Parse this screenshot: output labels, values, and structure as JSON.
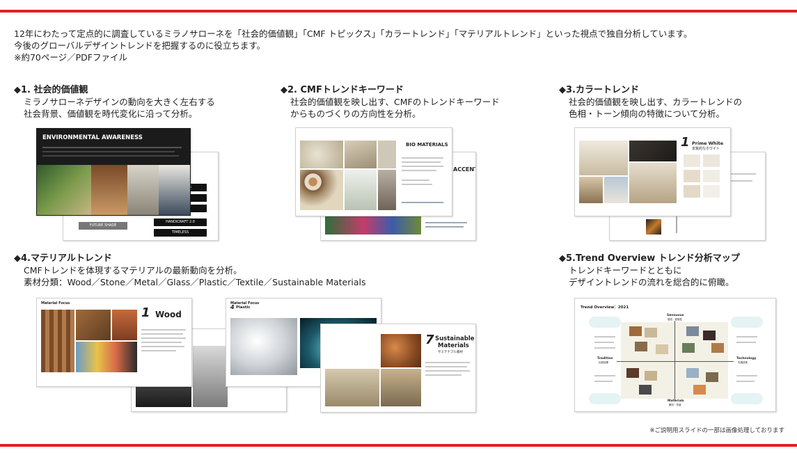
{
  "intro": {
    "line1": "12年にわたって定点的に調査しているミラノサローネを「社会的価値観」「CMF トピックス」「カラートレンド」「マテリアルトレンド」といった視点で独自分析しています。",
    "line2": "今後のグローバルデザイントレンドを把握するのに役立ちます。",
    "line3": "※約70ページ／PDFファイル"
  },
  "sections": [
    {
      "title": "◆1. 社会的価値観",
      "desc1": "ミラノサローネデザインの動向を大きく左右する",
      "desc2": "社会背景、価値観を時代変化に沿って分析。"
    },
    {
      "title": "◆2. CMFトレンドキーワード",
      "desc1": "社会的価値観を映し出す、CMFのトレンドキーワード",
      "desc2": "からものづくりの方向性を分析。"
    },
    {
      "title": "◆3.カラートレンド",
      "desc1": "社会的価値観を映し出す、カラートレンドの",
      "desc2": "色相・トーン傾向の特徴について分析。"
    },
    {
      "title": "◆4.マテリアルトレンド",
      "desc1": "CMFトレンドを体現するマテリアルの最新動向を分析。",
      "desc2": "素材分類：Wood／Stone／Metal／Glass／Plastic／Textile／Sustainable Materials"
    },
    {
      "title": "◆5.Trend Overview トレンド分析マップ",
      "desc1": "トレンドキーワードとともに",
      "desc2": "デザイントレンドの流れを総合的に俯瞰。"
    }
  ],
  "slides": {
    "env_title": "ENVIRONMENTAL AWARENESS",
    "env_btn1": "HARMONESS",
    "env_btn2": "HANDICRAFT 2.0",
    "env_btn3": "TIMELESS",
    "env_btn4": "FUTURE SHADE",
    "bio_title": "BIO MATERIALS",
    "accents": "ACCENTS",
    "color_no": "1",
    "color_title": "Prime White",
    "color_sub": "本質的なホワイト",
    "wood_no": "1",
    "wood_title": "Wood",
    "material_focus": "Material Focus",
    "plastic_no": "4",
    "plastic_title": "Plastic",
    "sust_no": "7",
    "sust_title1": "Sustainable",
    "sust_title2": "Materials",
    "sust_sub": "サステナブル素材",
    "overview_title": "Trend Overview：2021",
    "ov_top": "Sensuous",
    "ov_top_sub": "感覚・官能性",
    "ov_left": "Tradition",
    "ov_left_sub": "伝統回帰",
    "ov_right": "Technology",
    "ov_right_sub": "先端技術",
    "ov_bottom": "Materials",
    "ov_bottom_sub": "素材・質感"
  },
  "footnote": "※ご説明用スライドの一部は画像処理しております",
  "colors": {
    "accent": "#e02020"
  }
}
